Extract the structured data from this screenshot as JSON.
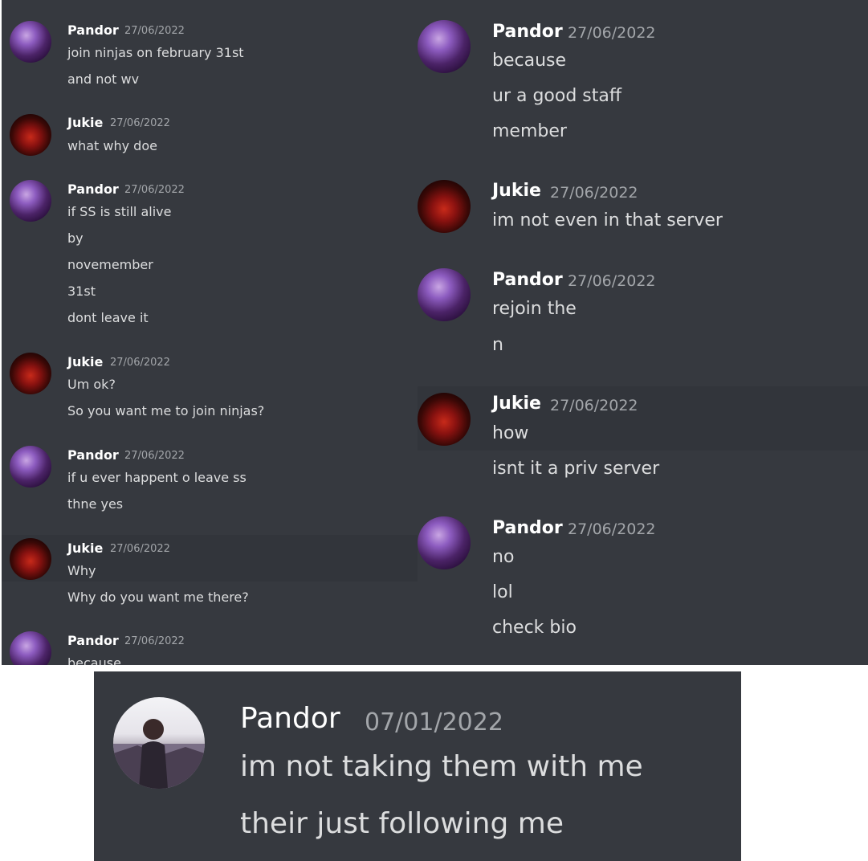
{
  "left": {
    "messages": [
      {
        "author": "Pandor",
        "timestamp": "27/06/2022",
        "avatar": "pandor-avatar",
        "lines": [
          "join ninjas on february 31st",
          "and not wv"
        ]
      },
      {
        "author": "Jukie",
        "timestamp": "27/06/2022",
        "avatar": "jukie-avatar",
        "lines": [
          "what why doe"
        ]
      },
      {
        "author": "Pandor",
        "timestamp": "27/06/2022",
        "avatar": "pandor-avatar",
        "lines": [
          "if SS is still alive",
          "by",
          "novemember",
          "31st",
          "dont leave it"
        ]
      },
      {
        "author": "Jukie",
        "timestamp": "27/06/2022",
        "avatar": "jukie-avatar",
        "lines": [
          "Um ok?",
          "So you want me to join ninjas?"
        ]
      },
      {
        "author": "Pandor",
        "timestamp": "27/06/2022",
        "avatar": "pandor-avatar",
        "lines": [
          "if u ever happent o leave ss",
          "thne yes"
        ]
      },
      {
        "author": "Jukie",
        "timestamp": "27/06/2022",
        "avatar": "jukie-avatar",
        "lines": [
          "Why",
          "Why do you want me there?"
        ]
      },
      {
        "author": "Pandor",
        "timestamp": "27/06/2022",
        "avatar": "pandor-avatar",
        "lines": [
          "because"
        ]
      }
    ]
  },
  "right": {
    "messages": [
      {
        "author": "Pandor",
        "timestamp": "27/06/2022",
        "avatar": "pandor-avatar",
        "lines": [
          "because",
          "ur a good staff",
          "member"
        ]
      },
      {
        "author": "Jukie",
        "timestamp": "27/06/2022",
        "avatar": "jukie-avatar",
        "lines": [
          "im not even in that server"
        ]
      },
      {
        "author": "Pandor",
        "timestamp": "27/06/2022",
        "avatar": "pandor-avatar",
        "lines": [
          "rejoin the",
          "n"
        ]
      },
      {
        "author": "Jukie",
        "timestamp": "27/06/2022",
        "avatar": "jukie-avatar",
        "lines": [
          "how",
          "isnt it a priv server"
        ]
      },
      {
        "author": "Pandor",
        "timestamp": "27/06/2022",
        "avatar": "pandor-avatar",
        "lines": [
          "no",
          "lol",
          "check bio"
        ]
      }
    ]
  },
  "bottom": {
    "messages": [
      {
        "author": "Pandor",
        "timestamp": "07/01/2022",
        "avatar": "pandor-avatar",
        "lines": [
          "im not taking them with me",
          "their just following me"
        ]
      }
    ]
  }
}
